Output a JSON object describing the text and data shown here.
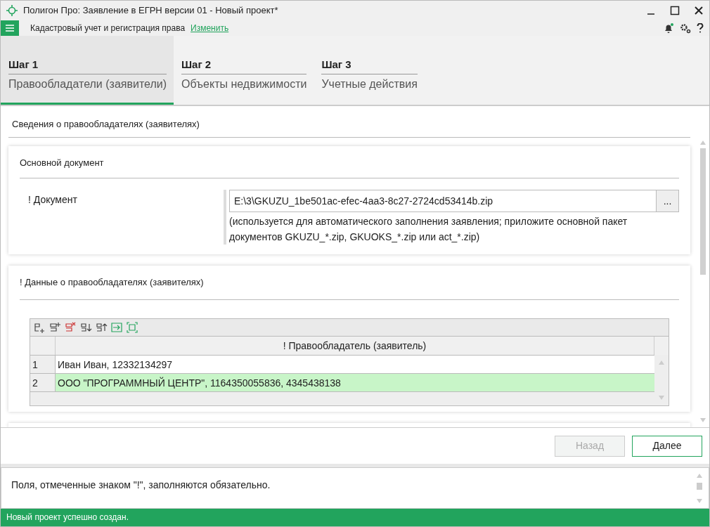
{
  "window": {
    "title": "Полигон Про: Заявление в ЕГРН версии 01 - Новый проект*"
  },
  "toolbar": {
    "section": "Кадастровый учет и регистрация права",
    "change_link": "Изменить"
  },
  "steps": [
    {
      "number": "Шаг 1",
      "label": "Правообладатели (заявители)",
      "selected": true
    },
    {
      "number": "Шаг 2",
      "label": "Объекты недвижимости",
      "selected": false
    },
    {
      "number": "Шаг 3",
      "label": "Учетные действия",
      "selected": false
    }
  ],
  "page_title": "Сведения о правообладателях (заявителях)",
  "main_document": {
    "title": "Основной документ",
    "label": "! Документ",
    "value": "E:\\3\\GKUZU_1be501ac-efec-4aa3-8c27-2724cd53414b.zip",
    "browse": "...",
    "hint": "(используется для автоматического заполнения заявления; приложите основной пакет документов GKUZU_*.zip, GKUOKS_*.zip или act_*.zip)"
  },
  "holders": {
    "title": "! Данные о правообладателях (заявителях)",
    "column": "! Правообладатель (заявитель)",
    "rows": [
      {
        "number": "1",
        "value": "Иван Иван, 12332134297",
        "selected": false
      },
      {
        "number": "2",
        "value": "ООО \"ПРОГРАММНЫЙ ЦЕНТР\", 1164350055836, 4345438138",
        "selected": true
      }
    ]
  },
  "buttons": [
    {
      "label": "Назад",
      "disabled": true
    },
    {
      "label": "Далее",
      "disabled": false
    }
  ],
  "hint": "Поля, отмеченные знаком \"!\", заполняются обязательно.",
  "status_bar": "Новый проект успешно создан."
}
